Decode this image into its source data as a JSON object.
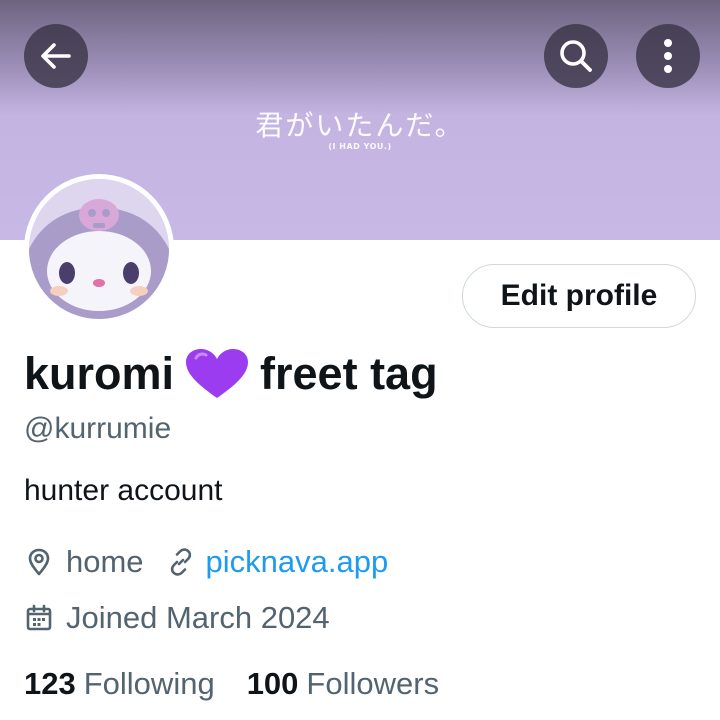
{
  "banner": {
    "text": "君がいたんだ。",
    "subtext": "(I HAD YOU.)",
    "background": "#c7b8e6"
  },
  "header": {
    "back_icon": "arrow-left-icon",
    "search_icon": "search-icon",
    "more_icon": "more-vertical-icon"
  },
  "profile": {
    "edit_label": "Edit profile",
    "name_before": "kuromi",
    "name_emoji": "purple-heart-icon",
    "name_after": "freet tag",
    "handle": "@kurrumie",
    "bio": "hunter account",
    "location": "home",
    "website": "picknava.app",
    "joined": "Joined March 2024"
  },
  "stats": {
    "following_count": "123",
    "following_label": "Following",
    "followers_count": "100",
    "followers_label": "Followers"
  },
  "colors": {
    "link": "#1d9bf0",
    "secondary_text": "#536471",
    "primary_text": "#0f1419",
    "heart": "#9b3cf0"
  }
}
